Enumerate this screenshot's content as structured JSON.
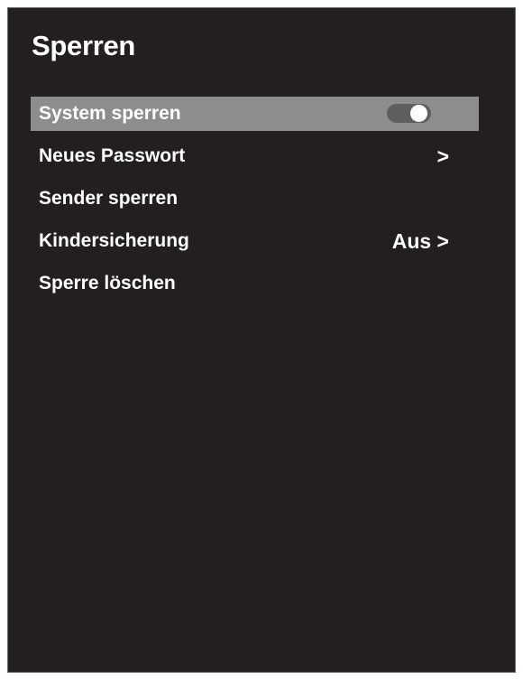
{
  "header": {
    "title": "Sperren"
  },
  "menu": {
    "items": [
      {
        "label": "System sperren",
        "value": "",
        "toggle_on": true
      },
      {
        "label": "Neues Passwort",
        "value": ">"
      },
      {
        "label": "Sender sperren",
        "value": ""
      },
      {
        "label": "Kindersicherung",
        "value": "Aus >"
      },
      {
        "label": "Sperre löschen",
        "value": ""
      }
    ]
  },
  "colors": {
    "background": "#231f20",
    "selected_row": "#8d8d8d",
    "toggle_track": "#5e5e5e",
    "text": "#ffffff"
  }
}
